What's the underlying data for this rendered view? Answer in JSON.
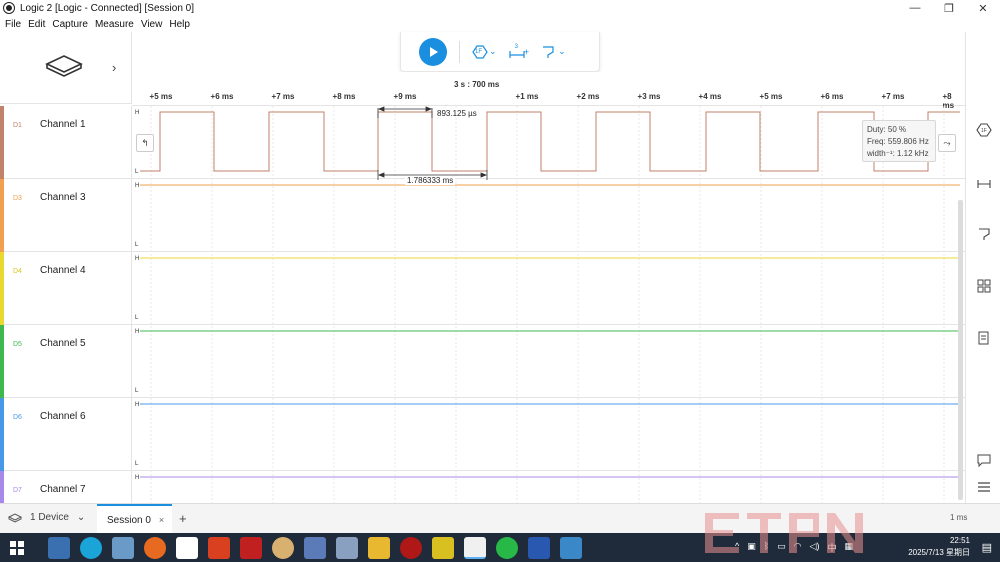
{
  "window": {
    "title": "Logic 2 [Logic - Connected] [Session 0]",
    "minimize": "—",
    "maximize": "❐",
    "close": "✕"
  },
  "menu": [
    "File",
    "Edit",
    "Capture",
    "Measure",
    "View",
    "Help"
  ],
  "toolbar": {
    "play_icon": "play-icon",
    "trigger_label": "1F",
    "measure_label": "3",
    "measure_plus": "+"
  },
  "timeline": {
    "center_label": "3 s : 700 ms",
    "ticks": [
      "+5 ms",
      "+6 ms",
      "+7 ms",
      "+8 ms",
      "+9 ms",
      "+1 ms",
      "+2 ms",
      "+3 ms",
      "+4 ms",
      "+5 ms",
      "+6 ms",
      "+7 ms",
      "+8 ms"
    ]
  },
  "channels": [
    {
      "id": "D1",
      "name": "Channel 1",
      "color": "#c0826b"
    },
    {
      "id": "D3",
      "name": "Channel 3",
      "color": "#f0a050"
    },
    {
      "id": "D4",
      "name": "Channel 4",
      "color": "#e8d830"
    },
    {
      "id": "D5",
      "name": "Channel 5",
      "color": "#40b850"
    },
    {
      "id": "D6",
      "name": "Channel 6",
      "color": "#4898e8"
    },
    {
      "id": "D7",
      "name": "Channel 7",
      "color": "#a888e8"
    }
  ],
  "levels": {
    "high": "H",
    "low": "L"
  },
  "measurements": {
    "pulse_width": "893.125 µs",
    "period": "1.786333 ms",
    "duty": "Duty: 50 %",
    "freq": "Freq: 559.806 Hz",
    "width_inv": "width⁻¹: 1.12 kHz"
  },
  "bottom": {
    "device_label": "1 Device",
    "session_tab": "Session 0",
    "close_glyph": "×",
    "add_glyph": "+",
    "zoom_label": "1 ms"
  },
  "taskbar": {
    "time": "22:51",
    "date": "2025/7/13 星期日",
    "ime": "中"
  },
  "colors": {
    "accent": "#1a8fe0",
    "taskbar": "#1f2b3a"
  }
}
